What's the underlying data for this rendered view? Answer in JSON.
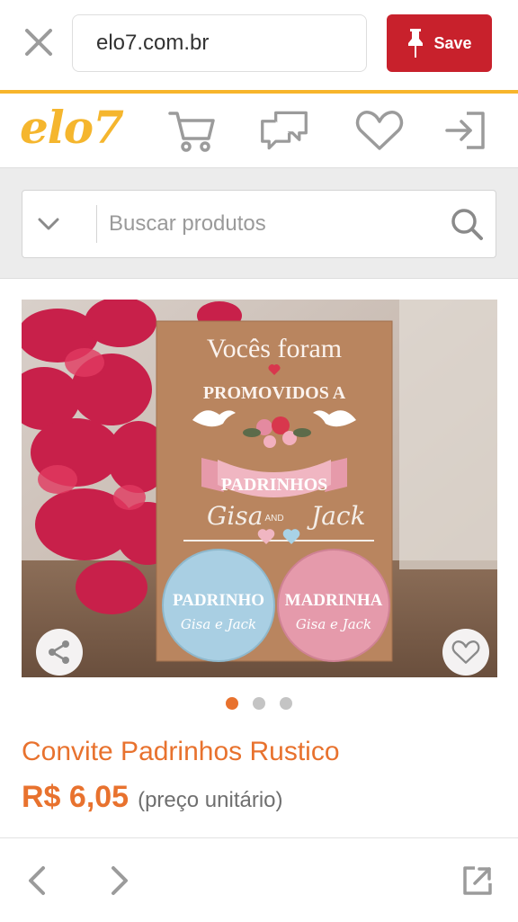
{
  "browser": {
    "url": "elo7.com.br",
    "save_label": "Save"
  },
  "site": {
    "logo": "elo7"
  },
  "search": {
    "placeholder": "Buscar produtos",
    "value": ""
  },
  "product": {
    "image_description": "",
    "card": {
      "line1": "Vocês foram",
      "line2": "PROMOVIDOS A",
      "ribbon": "PADRINHOS",
      "name_left": "Gisa",
      "name_and": "AND",
      "name_right": "Jack",
      "button_left_title": "PADRINHO",
      "button_left_names": "Gisa e Jack",
      "button_right_title": "MADRINHA",
      "button_right_names": "Gisa e Jack"
    },
    "title": "Convite Padrinhos Rustico",
    "price": "R$ 6,05",
    "price_note": "(preço unitário)",
    "carousel": {
      "count": 3,
      "active_index": 0
    }
  },
  "colors": {
    "accent": "#e8722e",
    "brand_yellow": "#f5b62e",
    "save_red": "#c8212c",
    "icon_gray": "#9b9b9b"
  },
  "icons": [
    "close-icon",
    "pin-icon",
    "cart-icon",
    "chat-icon",
    "heart-icon",
    "login-icon",
    "chevron-down-icon",
    "search-icon",
    "share-icon",
    "favorite-icon",
    "arrow-left-icon",
    "arrow-right-icon",
    "external-link-icon"
  ]
}
